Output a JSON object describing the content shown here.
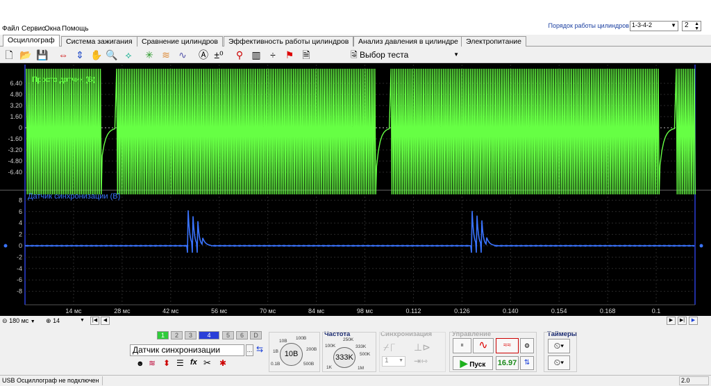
{
  "menu": {
    "items": [
      "Файл",
      "Сервис",
      "Окна",
      "Помощь"
    ]
  },
  "cylinder_order": {
    "label": "Порядок работы цилиндров",
    "value": "1-3-4-2",
    "count": "2"
  },
  "tabs": [
    {
      "label": "Осциллограф",
      "active": true
    },
    {
      "label": "Система зажигания"
    },
    {
      "label": "Сравнение цилиндров"
    },
    {
      "label": "Эффективность работы цилиндров"
    },
    {
      "label": "Анализ давления в цилиндре"
    },
    {
      "label": "Электропитание"
    }
  ],
  "toolbar": {
    "test_select": "Выбор теста"
  },
  "icons": {
    "new": "new-file-icon",
    "open": "open-folder-icon",
    "save": "save-icon"
  },
  "chart_data": [
    {
      "type": "line",
      "title": "",
      "series": [
        {
          "name": "Просто датчик (В)",
          "color": "#66ff44"
        }
      ],
      "ylabel": "",
      "yticks": [
        "6.40",
        "4.80",
        "3.20",
        "1.60",
        "0",
        "-1.60",
        "-3.20",
        "-4.80",
        "-6.40"
      ],
      "ylim": [
        -8,
        8
      ],
      "description": "high-frequency oscillation clipped at ±8, with four dropouts to baseline"
    },
    {
      "type": "line",
      "title": "",
      "series": [
        {
          "name": "Датчик синхронизации (В)",
          "color": "#3a74ff"
        }
      ],
      "yticks": [
        "8",
        "6",
        "4",
        "2",
        "0",
        "-2",
        "-4",
        "-6",
        "-8"
      ],
      "ylim": [
        -10,
        10
      ],
      "pulse_bursts": [
        {
          "x_ms": 42,
          "peaks": [
            7.2,
            6.0,
            5.0
          ]
        },
        {
          "x_ms": 114,
          "peaks": [
            6.6,
            5.7,
            4.8
          ]
        }
      ],
      "xticks": [
        "14 мс",
        "28 мс",
        "42 мс",
        "56 мс",
        "70 мс",
        "84 мс",
        "98 мс",
        "0.112",
        "0.126",
        "0.140",
        "0.154",
        "0.168",
        "0.1"
      ]
    }
  ],
  "bottom_nav": {
    "timebase": "180 мс",
    "zoom": "14"
  },
  "channels": {
    "buttons": [
      "1",
      "2",
      "3",
      "4",
      "5",
      "6",
      "D"
    ],
    "selected_name": "Датчик синхронизации"
  },
  "controls": {
    "voltage_knob": "10B",
    "voltage_labels": [
      "10B",
      "100B",
      "200B",
      "500B",
      "0.1B",
      "1B"
    ],
    "frequency_title": "Частота",
    "frequency_knob": "333K",
    "frequency_labels": [
      "250K",
      "100K",
      "333K",
      "500K",
      "1K",
      "1M"
    ],
    "sync_title": "Синхронизация",
    "sync_value": "1",
    "control_title": "Управление",
    "start_label": "Пуск",
    "rate_value": "16.97",
    "timers_title": "Таймеры"
  },
  "status": {
    "connection": "USB Осциллограф не подключен",
    "version": "2.0"
  }
}
